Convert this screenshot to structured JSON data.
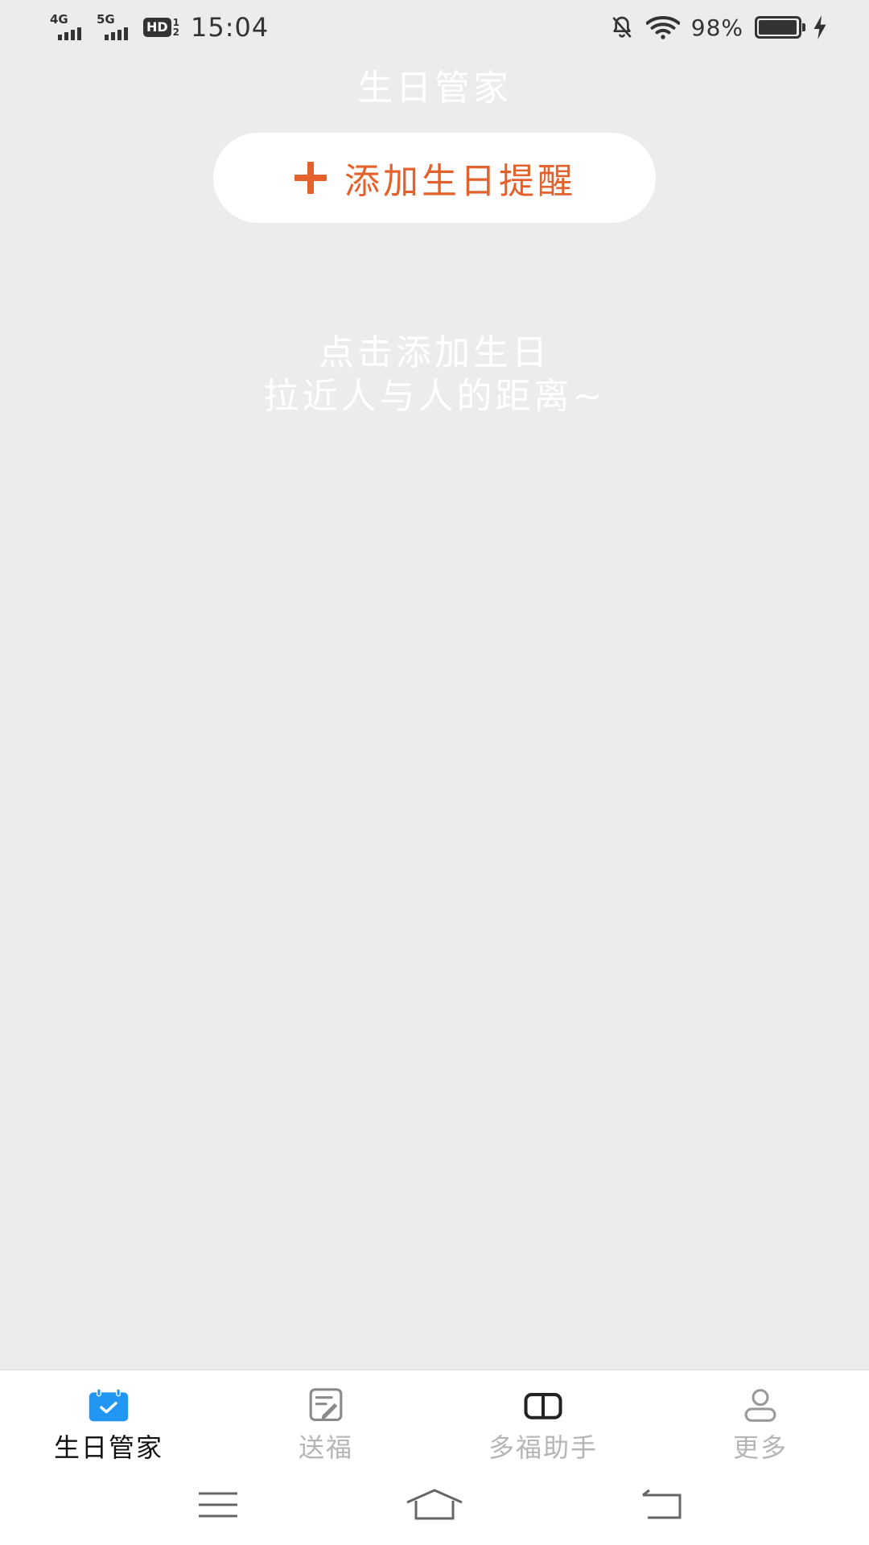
{
  "status_bar": {
    "network_1": "4G",
    "network_2": "5G",
    "hd_label": "HD",
    "hd_sim_top": "1",
    "hd_sim_bottom": "2",
    "time": "15:04",
    "battery_percent": "98%",
    "battery_level": 0.98,
    "icons": [
      "bell-off-icon",
      "wifi-icon",
      "battery-icon",
      "charging-icon"
    ]
  },
  "header": {
    "title": "生日管家"
  },
  "add_button": {
    "label": "添加生日提醒",
    "icon": "plus-icon",
    "color": "#e4612b"
  },
  "empty_state": {
    "line1": "点击添加生日",
    "line2": "拉近人与人的距离~"
  },
  "bottom_nav": {
    "items": [
      {
        "label": "生日管家",
        "icon": "calendar-check-icon",
        "active": true
      },
      {
        "label": "送福",
        "icon": "edit-note-icon",
        "active": false
      },
      {
        "label": "多福助手",
        "icon": "book-icon",
        "active": false
      },
      {
        "label": "更多",
        "icon": "user-icon",
        "active": false
      }
    ],
    "active_color": "#2196f3"
  },
  "system_nav": {
    "icons": [
      "menu-icon",
      "home-icon",
      "back-icon"
    ]
  }
}
